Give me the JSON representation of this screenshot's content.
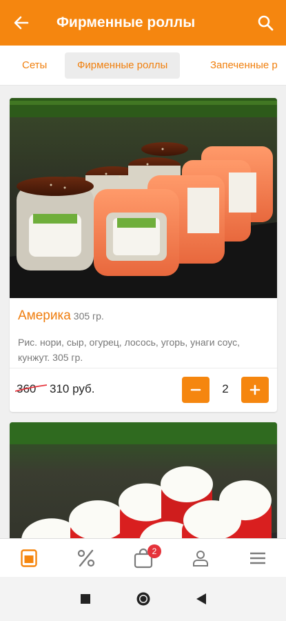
{
  "header": {
    "title": "Фирменные роллы",
    "back_icon": "arrow-left-icon",
    "search_icon": "search-icon",
    "accent_color": "#f5860f"
  },
  "tabs": [
    {
      "label": "Сеты",
      "active": false
    },
    {
      "label": "Фирменные роллы",
      "active": true
    },
    {
      "label": "Запеченные р",
      "active": false
    }
  ],
  "products": [
    {
      "name": "Америка",
      "weight": "305 гр.",
      "description": "Рис. нори, сыр, огурец, лосось, угорь, унаги соус, кунжут. 305 гр.",
      "old_price": "360",
      "price": "310 руб.",
      "quantity": "2",
      "image": "salmon-eel-rolls-photo"
    },
    {
      "image": "red-caviar-cream-rolls-photo"
    }
  ],
  "bottom_nav": {
    "items": [
      "menu-icon",
      "discount-icon",
      "cart-icon",
      "profile-icon",
      "hamburger-icon"
    ],
    "cart_badge": "2",
    "active": "menu-icon"
  },
  "system_nav": [
    "recent-apps-icon",
    "home-icon",
    "back-icon"
  ]
}
